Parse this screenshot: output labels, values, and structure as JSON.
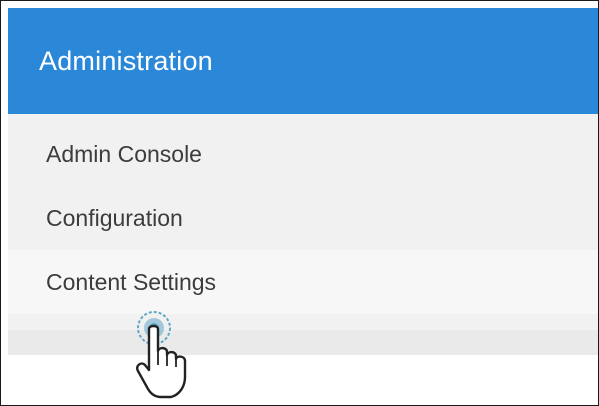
{
  "menu": {
    "header_title": "Administration",
    "items": [
      {
        "label": "Admin Console"
      },
      {
        "label": "Configuration"
      },
      {
        "label": "Content Settings",
        "state": "hovered"
      }
    ]
  },
  "colors": {
    "header_bg": "#2b88d8",
    "menu_bg": "#f1f1f1",
    "hover_bg": "#f7f7f7",
    "item_text": "#3c3c3c",
    "click_ripple": "#5fa8c8"
  },
  "cursor": {
    "icon": "hand-pointer-icon",
    "action": "click"
  }
}
